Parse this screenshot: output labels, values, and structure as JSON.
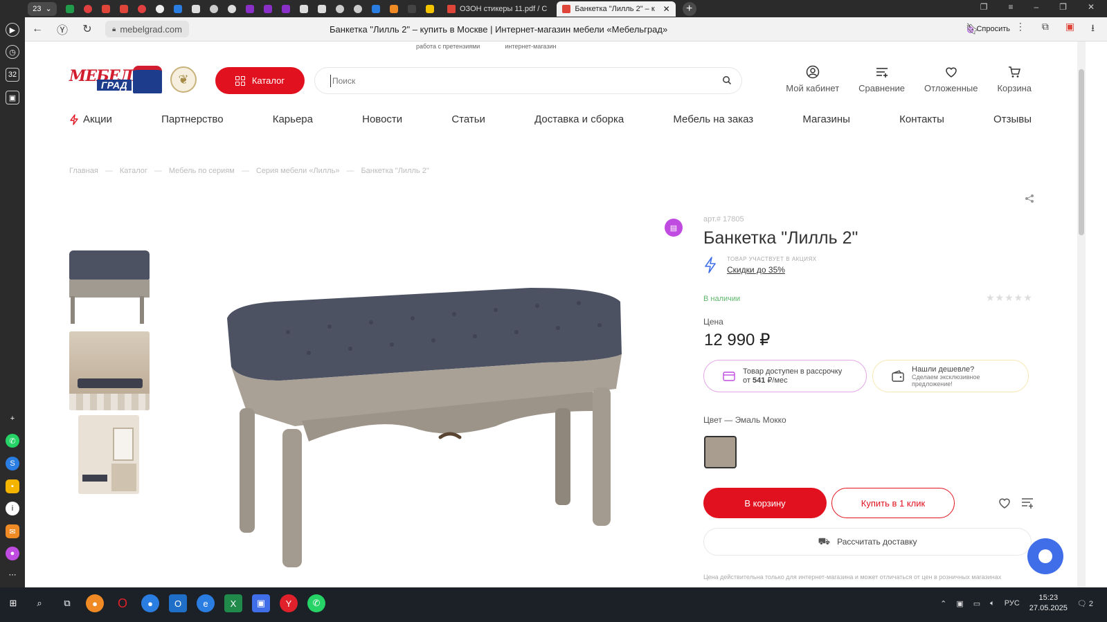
{
  "browser": {
    "tab_counter": "23",
    "tabs": [
      {
        "label": "ОЗОН стикеры 11.pdf / С"
      },
      {
        "label": "Банкетка \"Лилль 2\" – к"
      }
    ],
    "domain": "mebelgrad.com",
    "page_title": "Банкетка \"Лилль 2\" – купить в Москве | Интернет-магазин мебели «Мебельград»",
    "ask_label": "Спросить"
  },
  "site": {
    "topline": [
      "работа с претензиями",
      "интернет-магазин"
    ],
    "logo": {
      "line1": "МЕБЕЛЬ",
      "line2": "ГРАД"
    },
    "catalog_label": "Каталог",
    "search_placeholder": "Поиск",
    "header_icons": [
      {
        "label": "Мой кабинет",
        "icon": "user-icon"
      },
      {
        "label": "Сравнение",
        "icon": "compare-icon"
      },
      {
        "label": "Отложенные",
        "icon": "heart-icon"
      },
      {
        "label": "Корзина",
        "icon": "cart-icon"
      }
    ],
    "menu": [
      "Акции",
      "Партнерство",
      "Карьера",
      "Новости",
      "Статьи",
      "Доставка и сборка",
      "Мебель на заказ",
      "Магазины",
      "Контакты",
      "Отзывы"
    ],
    "breadcrumbs": [
      "Главная",
      "Каталог",
      "Мебель по сериям",
      "Серия мебели «Лилль»",
      "Банкетка \"Лилль 2\""
    ]
  },
  "product": {
    "article": "арт.# 17805",
    "title": "Банкетка \"Лилль 2\"",
    "promo_small": "ТОВАР УЧАСТВУЕТ В АКЦИЯХ",
    "promo_link": "Скидки до 35%",
    "stock": "В наличии",
    "rating": 0,
    "price_label": "Цена",
    "price": "12 990 ₽",
    "credit": {
      "line1": "Товар доступен в рассрочку",
      "prefix": "от ",
      "amount": "541",
      "suffix": " ₽/мес"
    },
    "cheaper": {
      "title": "Нашли дешевле?",
      "sub": "Сделаем эксклюзивное предложение!"
    },
    "color_label": "Цвет",
    "color_value": "Эмаль Мокко",
    "swatch_color": "#a89d8e",
    "cart_button": "В корзину",
    "one_click_button": "Купить в 1 клик",
    "delivery_button": "Рассчитать доставку",
    "disclaimer": "Цена действительна только для интернет-магазина и может отличаться от цен в розничных магазинах"
  },
  "colors": {
    "accent": "#e2111f",
    "promo": "#c04be0",
    "stock": "#5db66a"
  },
  "taskbar": {
    "lang": "РУС",
    "time": "15:23",
    "date": "27.05.2025",
    "notifications": "2"
  }
}
